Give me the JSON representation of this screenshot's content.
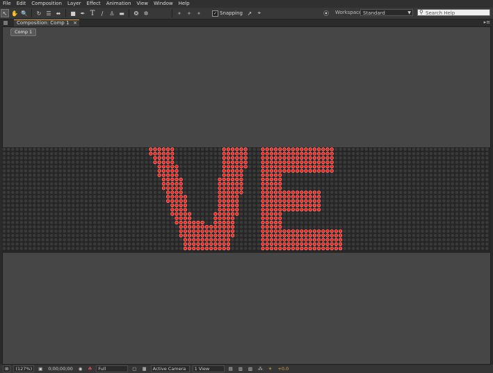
{
  "menu": [
    "File",
    "Edit",
    "Composition",
    "Layer",
    "Effect",
    "Animation",
    "View",
    "Window",
    "Help"
  ],
  "toolbar": {
    "tools": [
      "selection-icon",
      "hand-icon",
      "zoom-icon",
      "rotate-icon",
      "camera-orbit-icon",
      "pan-behind-icon",
      "rectangle-icon",
      "pen-icon",
      "text-icon",
      "brush-icon",
      "clone-stamp-icon",
      "eraser-icon",
      "roto-brush-icon",
      "puppet-pin-icon"
    ],
    "snapping_label": "Snapping",
    "snapping_checked": "✓",
    "workspace_label": "Workspace:",
    "workspace_value": "Standard",
    "search_placeholder": "Search Help"
  },
  "panel": {
    "tab_label": "Composition: Comp 1",
    "tab_close": "×",
    "comp_chip": "Comp 1"
  },
  "led": {
    "text": "VE",
    "on_color": "#ff2020",
    "off_color": "#3a3a3a"
  },
  "bottom": {
    "zoom": "(127%)",
    "timecode": "0;00;00;00",
    "resolution": "Full",
    "camera": "Active Camera",
    "view": "1 View",
    "exposure": "+0.0"
  }
}
